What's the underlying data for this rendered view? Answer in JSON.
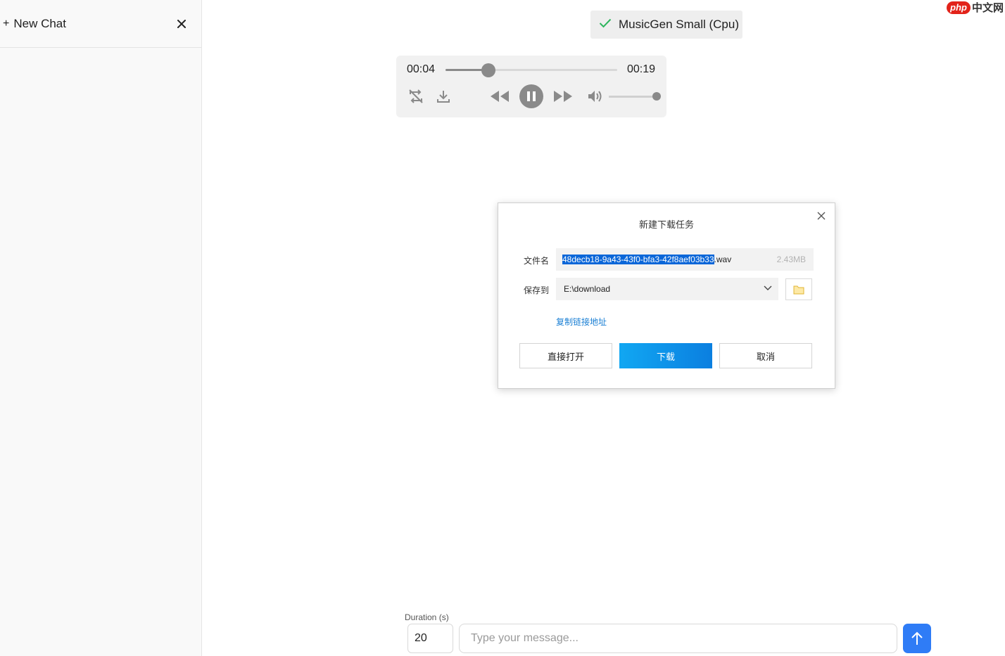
{
  "sidebar": {
    "new_chat_label": "New Chat",
    "plus": "+"
  },
  "model_badge": {
    "label": "MusicGen Small (Cpu)",
    "status_color": "#2db55d"
  },
  "player": {
    "current_time": "00:04",
    "duration": "00:19",
    "progress_fraction": 0.25,
    "volume_fraction": 1.0,
    "state": "playing"
  },
  "dialog": {
    "title": "新建下载任务",
    "filename_label": "文件名",
    "filename_selected": "48decb18-9a43-43f0-bfa3-42f8aef03b33",
    "filename_ext": ".wav",
    "file_size": "2.43MB",
    "save_label": "保存到",
    "save_path": "E:\\download",
    "copy_link": "复制链接地址",
    "open_button": "直接打开",
    "download_button": "下载",
    "cancel_button": "取消"
  },
  "composer": {
    "duration_label": "Duration (s)",
    "duration_value": "20",
    "message_placeholder": "Type your message..."
  },
  "watermark": {
    "php": "php",
    "cn": "中文网"
  }
}
